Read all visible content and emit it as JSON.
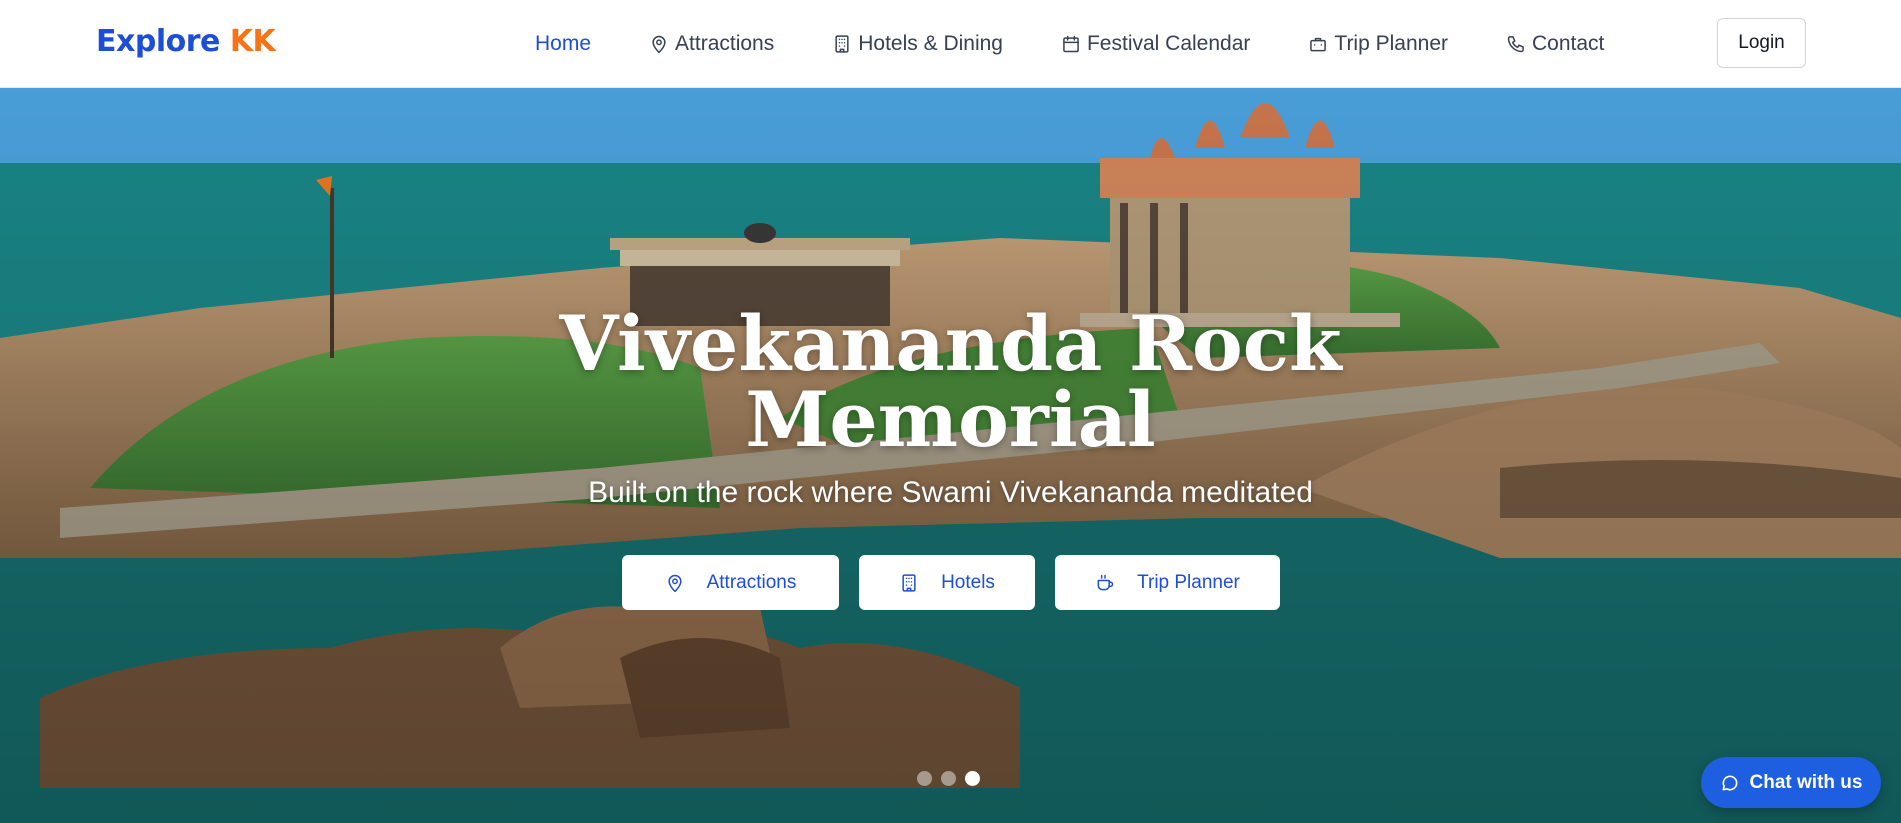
{
  "brand": {
    "part1": "Explore",
    "part2": "KK"
  },
  "nav": {
    "items": [
      {
        "label": "Home",
        "icon": "none",
        "active": true
      },
      {
        "label": "Attractions",
        "icon": "map-pin-icon"
      },
      {
        "label": "Hotels & Dining",
        "icon": "building-icon"
      },
      {
        "label": "Festival Calendar",
        "icon": "calendar-icon"
      },
      {
        "label": "Trip Planner",
        "icon": "briefcase-icon"
      },
      {
        "label": "Contact",
        "icon": "phone-icon"
      }
    ],
    "login_label": "Login"
  },
  "hero": {
    "title_line1": "Vivekananda Rock",
    "title_line2": "Memorial",
    "subtitle": "Built on the rock where Swami Vivekananda meditated",
    "buttons": [
      {
        "label": "Attractions",
        "icon": "map-pin-icon"
      },
      {
        "label": "Hotels",
        "icon": "building-icon"
      },
      {
        "label": "Trip Planner",
        "icon": "coffee-cup-icon"
      }
    ],
    "slides": {
      "count": 3,
      "active_index": 3
    }
  },
  "chat": {
    "label": "Chat with us",
    "icon": "chat-bubble-icon"
  },
  "colors": {
    "brand_blue": "#1d4ed8",
    "brand_orange": "#f97316",
    "chat_blue": "#1d5fe0"
  }
}
